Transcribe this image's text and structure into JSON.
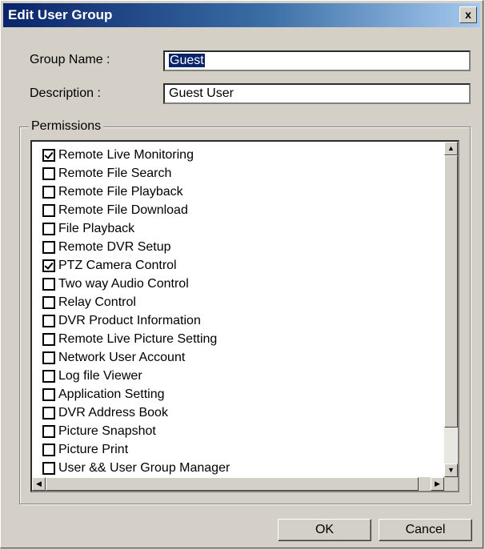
{
  "dialog": {
    "title": "Edit User Group",
    "close_label": "x"
  },
  "form": {
    "group_name_label": "Group Name :",
    "group_name_value": "Guest",
    "description_label": "Description :",
    "description_value": "Guest User"
  },
  "permissions": {
    "legend": "Permissions",
    "items": [
      {
        "label": "Remote Live Monitoring",
        "checked": true
      },
      {
        "label": "Remote File Search",
        "checked": false
      },
      {
        "label": "Remote File Playback",
        "checked": false
      },
      {
        "label": "Remote File Download",
        "checked": false
      },
      {
        "label": "File Playback",
        "checked": false
      },
      {
        "label": "Remote DVR Setup",
        "checked": false
      },
      {
        "label": "PTZ Camera Control",
        "checked": true
      },
      {
        "label": "Two way Audio Control",
        "checked": false
      },
      {
        "label": "Relay Control",
        "checked": false
      },
      {
        "label": "DVR Product Information",
        "checked": false
      },
      {
        "label": "Remote Live Picture Setting",
        "checked": false
      },
      {
        "label": "Network User Account",
        "checked": false
      },
      {
        "label": "Log file Viewer",
        "checked": false
      },
      {
        "label": "Application Setting",
        "checked": false
      },
      {
        "label": "DVR Address Book",
        "checked": false
      },
      {
        "label": "Picture Snapshot",
        "checked": false
      },
      {
        "label": "Picture Print",
        "checked": false
      },
      {
        "label": "User && User Group Manager",
        "checked": false
      }
    ]
  },
  "buttons": {
    "ok_label": "OK",
    "cancel_label": "Cancel"
  }
}
